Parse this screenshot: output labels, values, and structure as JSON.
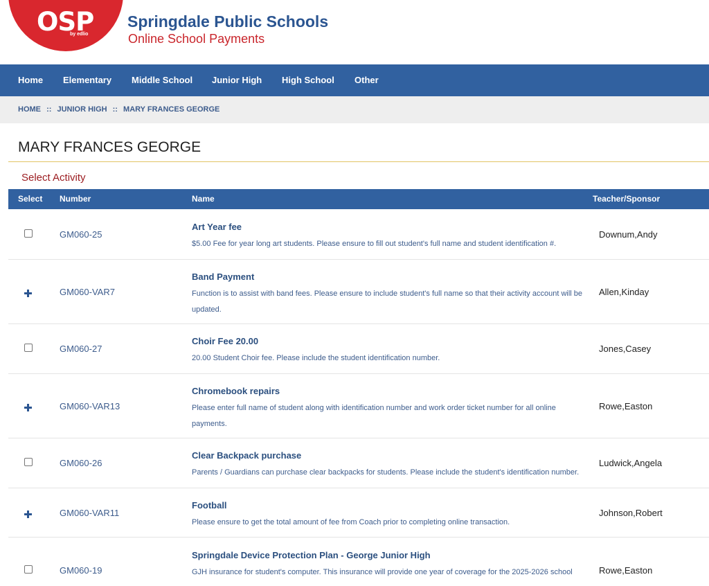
{
  "header": {
    "logo_text": "OSP",
    "logo_sub": "by edlio",
    "site_title": "Springdale Public Schools",
    "site_subtitle": "Online School Payments"
  },
  "nav": {
    "items": [
      {
        "label": "Home"
      },
      {
        "label": "Elementary"
      },
      {
        "label": "Middle School"
      },
      {
        "label": "Junior High"
      },
      {
        "label": "High School"
      },
      {
        "label": "Other"
      }
    ]
  },
  "breadcrumb": {
    "items": [
      "HOME",
      "JUNIOR HIGH",
      "MARY FRANCES GEORGE"
    ],
    "separator": "::"
  },
  "page": {
    "title": "MARY FRANCES GEORGE",
    "section": "Select Activity"
  },
  "table": {
    "columns": {
      "select": "Select",
      "number": "Number",
      "name": "Name",
      "teacher": "Teacher/Sponsor"
    },
    "rows": [
      {
        "select": "checkbox",
        "number": "GM060-25",
        "name": "Art Year fee",
        "description": "$5.00 Fee for year long art students. Please ensure to fill out student's full name and student identification #.",
        "teacher": "Downum,Andy"
      },
      {
        "select": "expand",
        "number": "GM060-VAR7",
        "name": "Band Payment",
        "description": "Function is to assist with band fees. Please ensure to include student's full name so that their activity account will be updated.",
        "teacher": "Allen,Kinday"
      },
      {
        "select": "checkbox",
        "number": "GM060-27",
        "name": "Choir Fee 20.00",
        "description": "20.00 Student Choir fee. Please include the student identification number.",
        "teacher": "Jones,Casey"
      },
      {
        "select": "expand",
        "number": "GM060-VAR13",
        "name": "Chromebook repairs",
        "description": "Please enter full name of student along with identification number and work order ticket number for all online payments.",
        "teacher": "Rowe,Easton"
      },
      {
        "select": "checkbox",
        "number": "GM060-26",
        "name": "Clear Backpack purchase",
        "description": "Parents / Guardians can purchase clear backpacks for students. Please include the student's identification number.",
        "teacher": "Ludwick,Angela"
      },
      {
        "select": "expand",
        "number": "GM060-VAR11",
        "name": "Football",
        "description": "Please ensure to get the total amount of fee from Coach prior to completing online transaction.",
        "teacher": "Johnson,Robert"
      },
      {
        "select": "checkbox",
        "number": "GM060-19",
        "name": "Springdale Device Protection Plan - George Junior High",
        "description": "GJH insurance for student's computer. This insurance will provide one year of coverage for the 2025-2026 school",
        "teacher": "Rowe,Easton"
      }
    ]
  },
  "colors": {
    "brand_red": "#d9272e",
    "nav_blue": "#3161a0",
    "title_blue": "#2b5591",
    "accent_gold": "#e2c463"
  }
}
